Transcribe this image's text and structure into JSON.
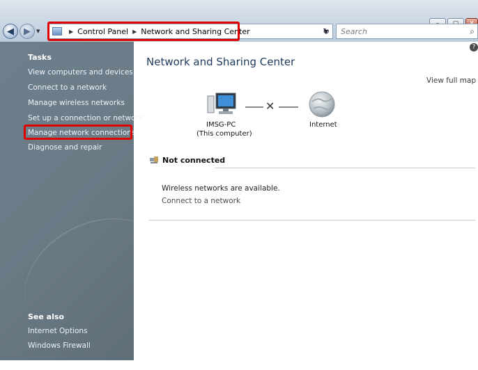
{
  "window": {
    "buttons": {
      "minimize": "–",
      "maximize": "▢",
      "close": "✕"
    }
  },
  "nav": {
    "back_glyph": "◀",
    "forward_glyph": "▶",
    "dropdown_glyph": "▼"
  },
  "address_bar": {
    "crumbs": [
      "Control Panel",
      "Network and Sharing Center"
    ],
    "separator": "▶",
    "dropdown_glyph": "▼",
    "refresh_glyph": "↻"
  },
  "search": {
    "placeholder": "Search",
    "icon": "⌕"
  },
  "left_pane": {
    "tasks_heading": "Tasks",
    "tasks": [
      "View computers and devices",
      "Connect to a network",
      "Manage wireless networks",
      "Set up a connection or network",
      "Manage network connections",
      "Diagnose and repair"
    ],
    "see_also_heading": "See also",
    "see_also": [
      "Internet Options",
      "Windows Firewall"
    ]
  },
  "main": {
    "title": "Network and Sharing Center",
    "help_glyph": "?",
    "view_full_map": "View full map",
    "map": {
      "computer_name": "IMSG-PC",
      "computer_sub": "(This computer)",
      "connection_glyph": "✕",
      "internet_label": "Internet"
    },
    "status_heading": "Not connected",
    "wireless_message": "Wireless networks are available.",
    "connect_link": "Connect to a network"
  },
  "colors": {
    "highlight": "#e00000",
    "pane_bg": "#6b7b86",
    "title_color": "#1e395b"
  }
}
